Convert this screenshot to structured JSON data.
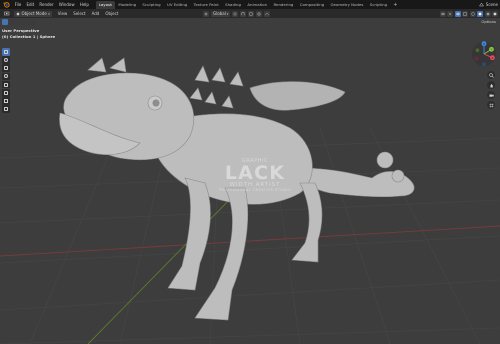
{
  "topbar": {
    "menus": [
      "File",
      "Edit",
      "Render",
      "Window",
      "Help"
    ],
    "workspace_tabs": [
      "Layout",
      "Modeling",
      "Sculpting",
      "UV Editing",
      "Texture Paint",
      "Shading",
      "Animation",
      "Rendering",
      "Compositing",
      "Geometry Nodes",
      "Scripting"
    ],
    "active_tab": "Layout",
    "add_tab": "+",
    "scene_label": "Scene"
  },
  "header": {
    "mode": "Object Mode",
    "menus": [
      "View",
      "Select",
      "Add",
      "Object"
    ],
    "transform_orientation": "Global",
    "options_label": "Options"
  },
  "viewport": {
    "view_name": "User Perspective",
    "collection_info": "(0) Collection 1 | Sphere",
    "watermark": {
      "top_line": "GRAPHIC",
      "main": "LACK",
      "sub": "WIDTH ARTIST",
      "tiny": "PROFESSIONAL CREATIVE STUDIO"
    },
    "gizmo_axes": [
      "Y",
      "X",
      "Z"
    ]
  },
  "colors": {
    "accent_blue": "#4772b3",
    "axis_x": "#e44a5f",
    "axis_y": "#8bc43f",
    "axis_z": "#3d8ce0",
    "model": "#bdbdbd"
  },
  "icons": {
    "logo": "blender-logo-icon",
    "scene": "scene-icon",
    "cursor": "cursor-icon",
    "move": "move-icon",
    "hand": "hand-icon",
    "camera": "camera-icon",
    "grid": "grid-icon"
  }
}
